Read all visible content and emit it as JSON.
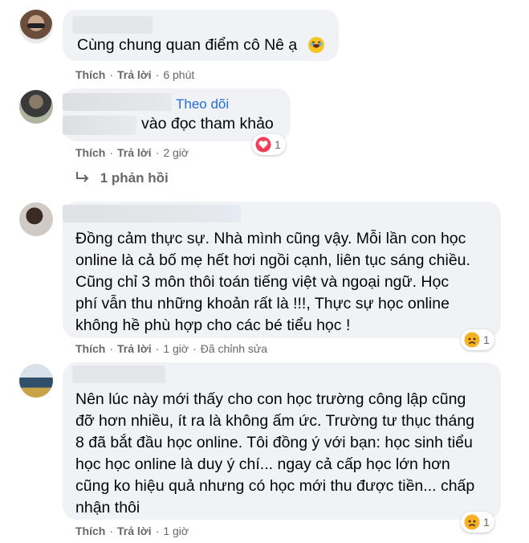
{
  "comments": [
    {
      "text": "Cùng chung quan điểm cô Nê ạ",
      "like": "Thích",
      "reply": "Trả lời",
      "time": "6 phút"
    },
    {
      "follow": "Theo dõi",
      "text": "vào đọc tham khảo",
      "like": "Thích",
      "reply": "Trả lời",
      "time": "2 giờ",
      "reaction_count": "1",
      "replies_label": "1 phản hồi"
    },
    {
      "text": "Đồng cảm thực sự. Nhà mình cũng vậy. Mỗi lần con học\nonline là cả bố mẹ hết hơi ngồi cạnh, liên tục sáng chiều.\nCũng chỉ 3 môn thôi toán tiếng việt và ngoại ngữ. Học\nphí vẫn thu những khoản rất là !!!, Thực sự học online\nkhông hề phù hợp cho các bé tiểu học !",
      "like": "Thích",
      "reply": "Trả lời",
      "time": "1 giờ",
      "edited": "Đã chỉnh sửa",
      "reaction_count": "1"
    },
    {
      "text": "Nên lúc này mới thấy cho con học trường công lập cũng\nđỡ hơn nhiều, ít ra là không ấm ức. Trường tư thục tháng\n8 đã bắt đầu học online. Tôi đồng ý với bạn: học sinh tiểu\nhọc học online là duy ý chí... ngay cả cấp học lớn hơn\ncũng ko hiệu quả nhưng có học mới thu được tiền... chấp\nnhận thôi",
      "like": "Thích",
      "reply": "Trả lời",
      "time": "1 giờ",
      "reaction_count": "1"
    }
  ],
  "colors": {
    "bubble": "#f0f2f5",
    "link": "#216fdb",
    "meta": "#65676b",
    "love": "#f33e58",
    "sad": "#f7b125"
  }
}
